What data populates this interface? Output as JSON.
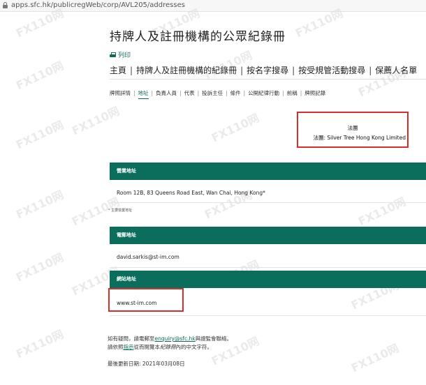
{
  "browser": {
    "url": "apps.sfc.hk/publicregWeb/corp/AVL205/addresses"
  },
  "page": {
    "title": "持牌人及註冊機構的公眾紀錄冊",
    "print_label": "列印"
  },
  "main_nav": {
    "items": [
      "主頁",
      "持牌人及註冊機構的紀錄冊",
      "按名字搜尋",
      "按受規管活動搜尋",
      "保薦人名單"
    ],
    "separator": "|"
  },
  "sub_tabs": {
    "items": [
      "牌照詳情",
      "地址",
      "負責人員",
      "代表",
      "投訴主任",
      "條件",
      "公開紀律行動",
      "前稱",
      "牌照記錄"
    ],
    "active": "地址",
    "separator": "|"
  },
  "entity": {
    "type_label": "法團",
    "name_line": "法團: Silver Tree Hong Kong Limited"
  },
  "sections": {
    "business_address": {
      "header": "營業地址",
      "value": "Room 12B, 83 Queens Road East, Wan Chai, Hong Kong*",
      "note": "* 主要營業地址"
    },
    "email": {
      "header": "電郵地址",
      "value": "david.sarkis@st-im.com"
    },
    "website": {
      "header": "網站地址",
      "value": "www.st-im.com"
    }
  },
  "footer": {
    "line1_prefix": "如有疑問，請電郵至",
    "line1_email": "enquiry@sfc.hk",
    "line1_suffix": "與證監會聯絡。",
    "line2_prefix": "請依照",
    "line2_link": "指示",
    "line2_middle": "從而閱覽本",
    "line2_italic": "紀錄冊",
    "line2_suffix": "內的中文字符。",
    "last_updated": "最後更新日期: 2021年03月08日"
  },
  "watermark": {
    "text": "FX110网"
  },
  "colors": {
    "accent": "#0b6e5d",
    "highlight_border": "#d32f2f"
  }
}
